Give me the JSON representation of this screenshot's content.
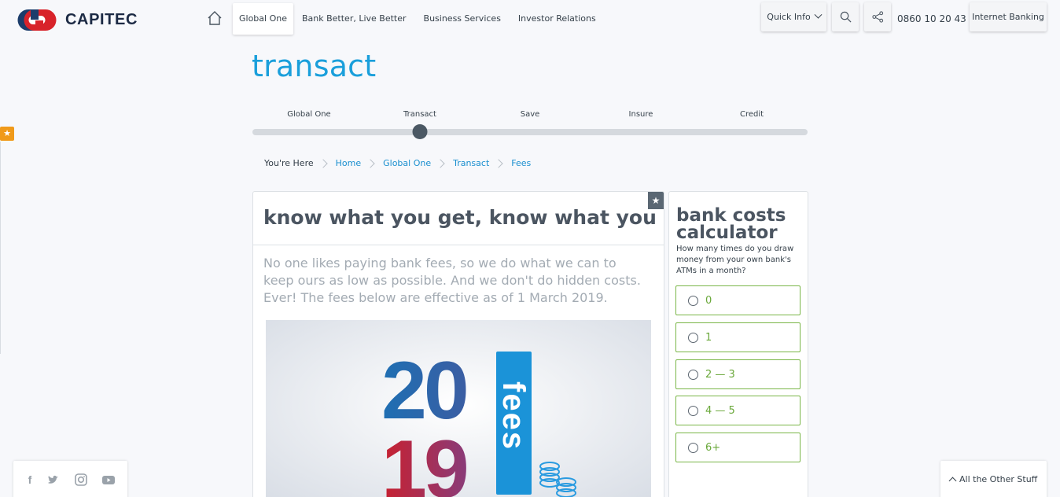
{
  "header": {
    "logo_text": "CAPITEC",
    "nav": [
      "Global One",
      "Bank Better, Live Better",
      "Business Services",
      "Investor Relations"
    ],
    "active_nav": "Global One",
    "quick_info": "Quick Info",
    "phone": "0860 10 20 43",
    "internet_banking": "Internet Banking"
  },
  "page": {
    "title": "transact"
  },
  "slider": {
    "steps": [
      "Global One",
      "Transact",
      "Save",
      "Insure",
      "Credit"
    ],
    "selected": "Transact",
    "selected_index": 1
  },
  "breadcrumb": {
    "prefix": "You're Here",
    "items": [
      "Home",
      "Global One",
      "Transact",
      "Fees"
    ]
  },
  "main_card": {
    "heading": "know what you get, know what you pay",
    "body": "No one likes paying bank fees, so we do what we can to keep ours as low as possible. And we don't do hidden costs. Ever! The fees below are effective as of 1 March 2019.",
    "image": {
      "year_top": "20",
      "year_bottom": "19",
      "word": "fees"
    }
  },
  "calculator": {
    "title": "bank costs calculator",
    "question": "How many times do you draw money from your own bank's ATMs in a month?",
    "options": [
      "0",
      "1",
      "2 — 3",
      "4 — 5",
      "6+"
    ]
  },
  "footer": {
    "other_stuff": "All the Other Stuff",
    "social_icons": [
      "facebook-icon",
      "twitter-icon",
      "instagram-icon",
      "youtube-icon"
    ]
  },
  "colors": {
    "brand_blue": "#1a9fdb",
    "brand_red": "#d8232a",
    "navy": "#1c2a44",
    "option_green": "#7ab648"
  }
}
